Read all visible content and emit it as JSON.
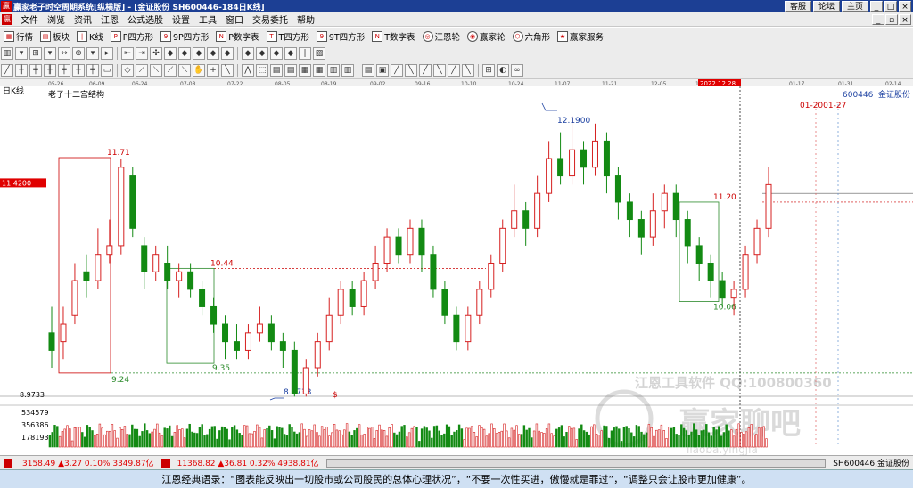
{
  "titlebar": {
    "app_icon": "贏",
    "title": "赢家老子时空周期系统[纵横版] - [金证股份  SH600446-184日K线]",
    "buttons": [
      "客服",
      "论坛",
      "主页"
    ]
  },
  "menubar": {
    "items": [
      "文件",
      "浏览",
      "资讯",
      "江恩",
      "公式选股",
      "设置",
      "工具",
      "窗口",
      "交易委托",
      "帮助"
    ]
  },
  "toolbar1": {
    "items": [
      "行情",
      "板块",
      "K线",
      "P四方形",
      "9P四方形",
      "P数字表",
      "T四方形",
      "9T四方形",
      "T数字表",
      "江恩轮",
      "赢家轮",
      "六角形",
      "赢家服务"
    ]
  },
  "chart": {
    "period_label": "日K线",
    "structure_label": "老子十二宫结构",
    "stock_code": "600446",
    "stock_name": "金证股份",
    "cursor_date": "2022.12.28",
    "future_dates": "01-2001-27",
    "current_price": "11.4200",
    "min_price_label": "8.9733",
    "watermark_line1": "江恩工具软件  QQ:100800360",
    "watermark_line2": "赢家聊吧",
    "watermark_url": "liaoba.yingjia",
    "dollar_marker": "$",
    "annotations": [
      "11.71",
      "9.24",
      "10.44",
      "9.35",
      "8.9733",
      "12.1900",
      "11.20",
      "10.06"
    ],
    "volume_labels": [
      "534579",
      "356386",
      "178193"
    ],
    "date_ticks": [
      "05-26",
      "06-09",
      "06-24",
      "07-08",
      "07-22",
      "08-05",
      "08-19",
      "09-02",
      "09-16",
      "10-10",
      "10-24",
      "11-07",
      "11-21",
      "12-05",
      "12-19",
      "01-17",
      "01-31",
      "02-14"
    ]
  },
  "chart_data": {
    "type": "candlestick",
    "title": "",
    "y_range": [
      8.9733,
      12.19
    ],
    "current_price": 11.42,
    "candles": [
      [
        9.7,
        9.5,
        10.0,
        9.3
      ],
      [
        9.6,
        9.8,
        10.0,
        9.4
      ],
      [
        9.9,
        10.3,
        10.5,
        9.8
      ],
      [
        10.4,
        10.3,
        10.6,
        10.1
      ],
      [
        10.3,
        10.6,
        10.9,
        10.2
      ],
      [
        10.6,
        10.7,
        11.0,
        10.5
      ],
      [
        10.7,
        11.6,
        11.7,
        10.6
      ],
      [
        11.5,
        10.9,
        11.6,
        10.8
      ],
      [
        10.7,
        10.4,
        10.8,
        10.2
      ],
      [
        10.4,
        10.6,
        10.7,
        10.3
      ],
      [
        10.5,
        10.3,
        10.7,
        10.2
      ],
      [
        10.3,
        10.4,
        10.5,
        10.1
      ],
      [
        10.4,
        10.2,
        10.5,
        10.1
      ],
      [
        10.2,
        10.0,
        10.3,
        9.9
      ],
      [
        10.0,
        9.8,
        10.1,
        9.7
      ],
      [
        9.8,
        9.6,
        9.9,
        9.4
      ],
      [
        9.6,
        9.5,
        9.8,
        9.4
      ],
      [
        9.5,
        9.7,
        9.8,
        9.4
      ],
      [
        9.7,
        9.8,
        10.0,
        9.6
      ],
      [
        9.8,
        9.6,
        9.9,
        9.5
      ],
      [
        9.6,
        9.5,
        9.7,
        9.3
      ],
      [
        9.5,
        9.0,
        9.6,
        8.97
      ],
      [
        9.0,
        9.3,
        9.4,
        8.97
      ],
      [
        9.3,
        9.6,
        9.7,
        9.2
      ],
      [
        9.6,
        9.9,
        10.1,
        9.5
      ],
      [
        9.9,
        10.2,
        10.3,
        9.8
      ],
      [
        10.2,
        10.0,
        10.3,
        9.9
      ],
      [
        10.0,
        10.3,
        10.4,
        9.9
      ],
      [
        10.3,
        10.5,
        10.7,
        10.2
      ],
      [
        10.5,
        10.8,
        10.9,
        10.4
      ],
      [
        10.8,
        10.6,
        10.9,
        10.5
      ],
      [
        10.6,
        10.9,
        11.0,
        10.5
      ],
      [
        10.9,
        10.6,
        11.0,
        10.4
      ],
      [
        10.6,
        10.2,
        10.7,
        10.1
      ],
      [
        10.2,
        9.9,
        10.3,
        9.8
      ],
      [
        9.9,
        9.6,
        10.0,
        9.5
      ],
      [
        9.6,
        9.9,
        10.0,
        9.5
      ],
      [
        9.9,
        10.2,
        10.3,
        9.8
      ],
      [
        10.2,
        10.5,
        10.6,
        10.1
      ],
      [
        10.5,
        10.9,
        11.0,
        10.4
      ],
      [
        10.9,
        11.1,
        11.4,
        10.8
      ],
      [
        11.1,
        10.9,
        11.2,
        10.7
      ],
      [
        10.9,
        11.3,
        11.5,
        10.8
      ],
      [
        11.3,
        11.7,
        11.9,
        11.2
      ],
      [
        11.7,
        11.5,
        12.0,
        11.4
      ],
      [
        11.5,
        11.8,
        12.19,
        11.4
      ],
      [
        11.8,
        11.6,
        11.9,
        11.4
      ],
      [
        11.6,
        11.9,
        12.1,
        11.5
      ],
      [
        11.9,
        11.5,
        12.0,
        11.3
      ],
      [
        11.5,
        11.2,
        11.6,
        11.0
      ],
      [
        11.2,
        11.0,
        11.3,
        10.8
      ],
      [
        11.0,
        10.8,
        11.1,
        10.6
      ],
      [
        10.8,
        11.1,
        11.3,
        10.7
      ],
      [
        11.1,
        11.3,
        11.4,
        10.9
      ],
      [
        11.3,
        11.0,
        11.4,
        10.8
      ],
      [
        11.0,
        10.7,
        11.1,
        10.5
      ],
      [
        10.7,
        10.5,
        10.8,
        10.3
      ],
      [
        10.5,
        10.3,
        10.6,
        10.1
      ],
      [
        10.3,
        10.1,
        10.4,
        10.0
      ],
      [
        10.1,
        10.2,
        10.3,
        9.9
      ],
      [
        10.2,
        10.6,
        10.7,
        10.1
      ],
      [
        10.6,
        10.9,
        11.0,
        10.5
      ],
      [
        10.9,
        11.4,
        11.6,
        10.8
      ]
    ],
    "volume_range": [
      0,
      534579
    ]
  }
}
